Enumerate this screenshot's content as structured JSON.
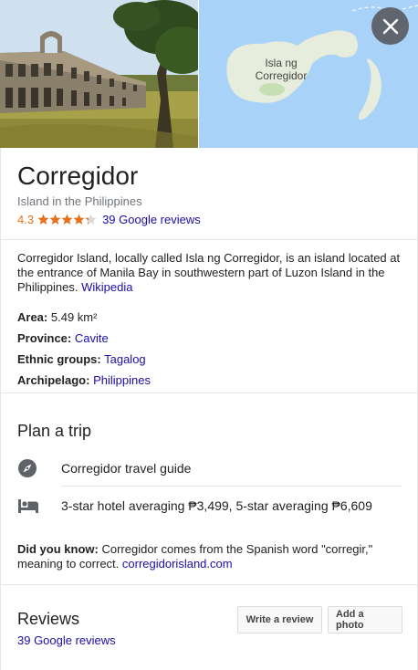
{
  "hero": {
    "photo_alt": "Corregidor ruins photo",
    "map_label": "Isla ng Corregidor",
    "close_icon": "close-icon"
  },
  "place": {
    "title": "Corregidor",
    "subtitle": "Island in the Philippines",
    "rating": "4.3",
    "rating_value": 4.3,
    "rating_max": 5,
    "reviews_link": "39 Google reviews"
  },
  "description": {
    "text": "Corregidor Island, locally called Isla ng Corregidor, is an island located at the entrance of Manila Bay in southwestern part of Luzon Island in the Philippines.",
    "source_link": "Wikipedia"
  },
  "facts": [
    {
      "label": "Area:",
      "value": "5.49 km²",
      "is_link": false
    },
    {
      "label": "Province:",
      "value": "Cavite",
      "is_link": true
    },
    {
      "label": "Ethnic groups:",
      "value": "Tagalog",
      "is_link": true
    },
    {
      "label": "Archipelago:",
      "value": "Philippines",
      "is_link": true
    }
  ],
  "plan": {
    "title": "Plan a trip",
    "items": [
      {
        "icon": "compass-icon",
        "label": "Corregidor travel guide"
      },
      {
        "icon": "hotel-bed-icon",
        "label": "3-star hotel averaging ₱3,499, 5-star averaging ₱6,609"
      }
    ]
  },
  "did_you_know": {
    "label": "Did you know:",
    "text": "Corregidor comes from the Spanish word \"corregir,\" meaning to correct.",
    "link": "corregidorisland.com"
  },
  "reviews": {
    "title": "Reviews",
    "link": "39 Google reviews",
    "write_button": "Write a review",
    "photo_button": "Add a photo"
  },
  "colors": {
    "link": "#1a0dab",
    "rating": "#e7711b",
    "star": "#e7711b",
    "close_button_bg": "#5f6670",
    "map_water": "#a8d2f7",
    "map_land": "#e8eee0"
  }
}
